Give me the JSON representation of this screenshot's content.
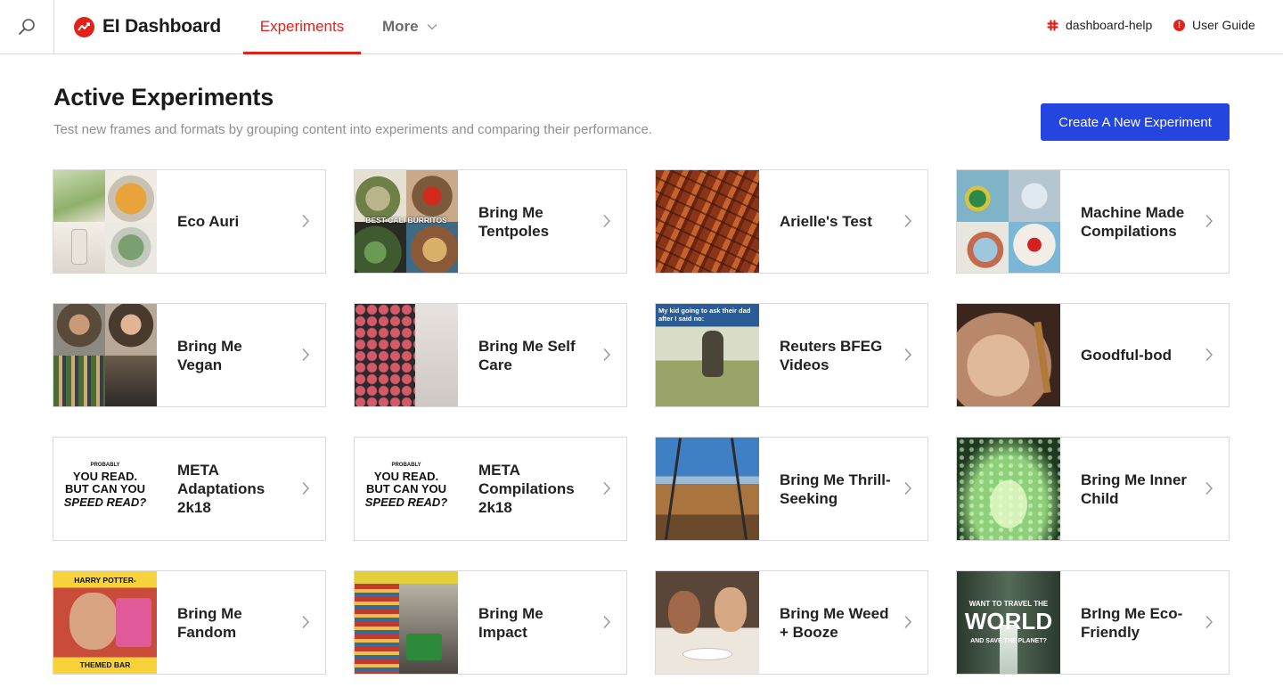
{
  "app": {
    "name": "EI Dashboard",
    "colors": {
      "accent": "#e32119",
      "primary_button": "#2545e0",
      "muted_text": "#8f8f8f",
      "border": "#d9d9d9"
    }
  },
  "topbar": {
    "search_icon": "search-icon",
    "tabs": [
      {
        "label": "Experiments",
        "active": true
      },
      {
        "label": "More",
        "active": false,
        "icon": "chevron-down-icon"
      }
    ],
    "links": [
      {
        "label": "dashboard-help",
        "icon": "slack-icon"
      },
      {
        "label": "User Guide",
        "icon": "info-icon"
      }
    ]
  },
  "header": {
    "title": "Active Experiments",
    "subtitle": "Test new frames and formats by grouping content into experiments and comparing their performance.",
    "create_button": "Create A New Experiment"
  },
  "thumb_text": {
    "burrito": "BEST CALI BURRITOS",
    "meme": "My kid going to ask their dad after I said no:",
    "meta_small": "PROBABLY",
    "meta_line1": "YOU READ.",
    "meta_line2": "BUT CAN YOU",
    "meta_line3": "SPEED READ?",
    "hp_top": "HARRY POTTER-",
    "hp_bottom": "THEMED BAR",
    "eco_line1": "WANT TO TRAVEL THE",
    "eco_line2": "WORLD",
    "eco_line3": "AND SAVE THE PLANET?"
  },
  "experiments": [
    {
      "title": "Eco Auri"
    },
    {
      "title": "Bring Me Tentpoles"
    },
    {
      "title": "Arielle's Test"
    },
    {
      "title": "Machine Made Compilations"
    },
    {
      "title": "Bring Me Vegan"
    },
    {
      "title": "Bring Me Self Care"
    },
    {
      "title": "Reuters BFEG Videos"
    },
    {
      "title": "Goodful-bod"
    },
    {
      "title": "META Adaptations 2k18"
    },
    {
      "title": "META Compilations 2k18"
    },
    {
      "title": "Bring Me Thrill-Seeking"
    },
    {
      "title": "Bring Me Inner Child"
    },
    {
      "title": "Bring Me Fandom"
    },
    {
      "title": "Bring Me Impact"
    },
    {
      "title": "Bring Me Weed + Booze"
    },
    {
      "title": "BrIng Me Eco-Friendly"
    }
  ]
}
